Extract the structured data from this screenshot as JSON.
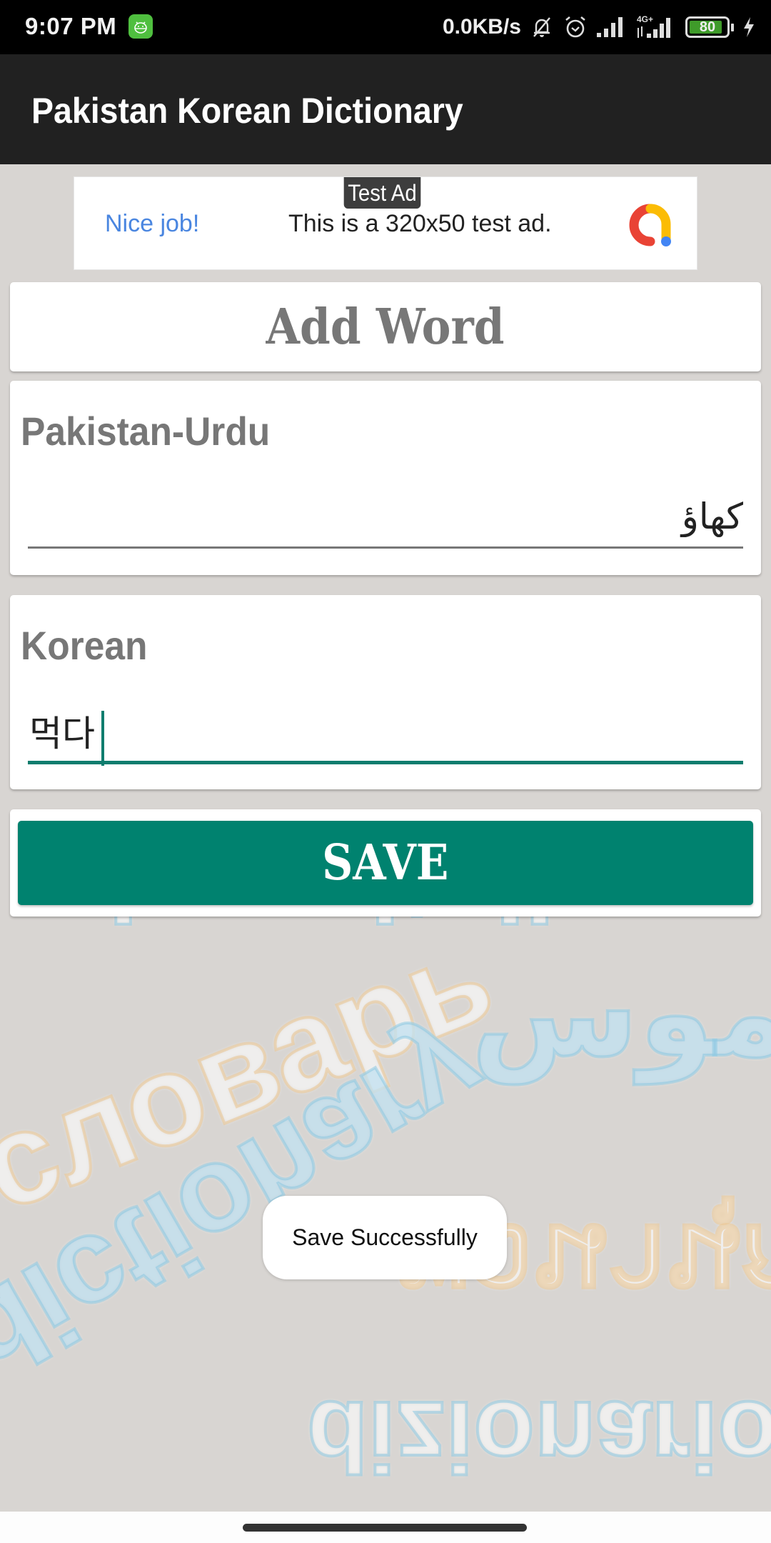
{
  "status_bar": {
    "time": "9:07 PM",
    "net_speed": "0.0KB/s",
    "network_type": "4G+",
    "battery_level": 80,
    "battery_label": "80",
    "icons": [
      "app-notification-icon",
      "bell-muted-icon",
      "alarm-icon",
      "signal-icon",
      "signal-4g-icon",
      "battery-icon",
      "charging-icon"
    ]
  },
  "app_bar": {
    "title": "Pakistan Korean Dictionary"
  },
  "ad": {
    "badge": "Test Ad",
    "headline": "Nice job!",
    "body": "This is a 320x50 test ad.",
    "logo": "admob-logo-icon"
  },
  "page": {
    "title": "Add Word"
  },
  "form": {
    "urdu": {
      "label": "Pakistan-Urdu",
      "value": "کھاؤ",
      "placeholder": ""
    },
    "korean": {
      "label": "Korean",
      "value": "먹다",
      "placeholder": "",
      "focused": true
    },
    "save_label": "SAVE"
  },
  "toast": {
    "message": "Save Successfully"
  },
  "background": {
    "watermark_words": [
      "dictionario",
      "قاموس",
      "словарь",
      "พจนานุกรม",
      "dictionary",
      "dizionario"
    ]
  },
  "colors": {
    "app_bar": "#212121",
    "accent": "#00826f",
    "label_gray": "#777777",
    "ad_headline": "#4a86e0"
  }
}
